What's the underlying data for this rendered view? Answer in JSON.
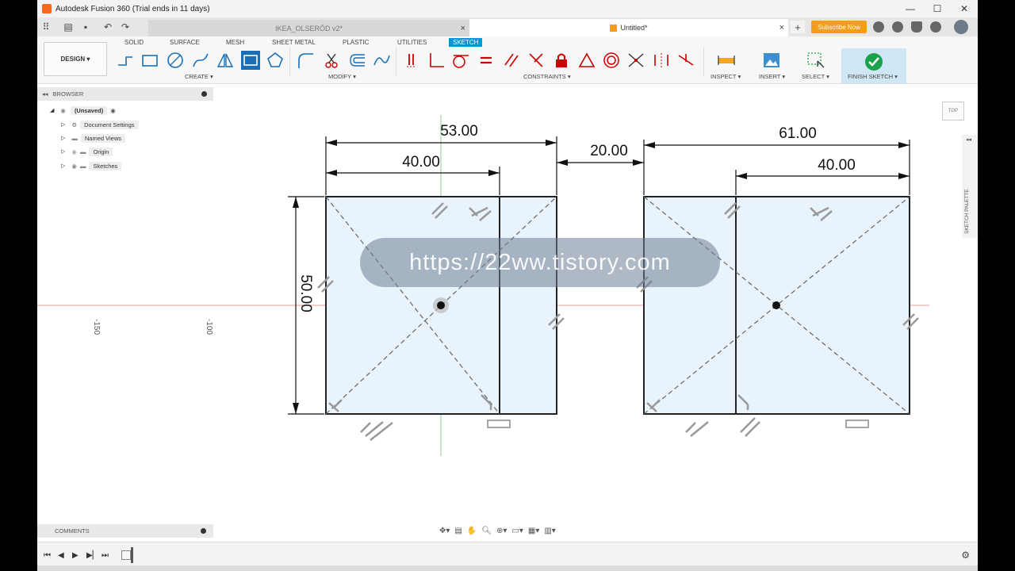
{
  "window": {
    "title": "Autodesk Fusion 360 (Trial ends in 11 days)"
  },
  "tabs": {
    "doc1": "IKEA_OLSERÖD v2*",
    "doc2": "Untitled*",
    "close": "×",
    "plus": "+"
  },
  "header": {
    "subscribe_label": "Subscribe Now"
  },
  "ribbon": {
    "tabs": [
      "SOLID",
      "SURFACE",
      "MESH",
      "SHEET METAL",
      "PLASTIC",
      "UTILITIES",
      "SKETCH"
    ],
    "workspace": "DESIGN ▾",
    "groups": {
      "create": "CREATE ▾",
      "modify": "MODIFY ▾",
      "constraints": "CONSTRAINTS ▾",
      "inspect": "INSPECT ▾",
      "insert": "INSERT ▾",
      "select": "SELECT ▾",
      "finish": "FINISH SKETCH ▾"
    }
  },
  "browser": {
    "title": "BROWSER",
    "root": "(Unsaved)",
    "items": [
      "Document Settings",
      "Named Views",
      "Origin",
      "Sketches"
    ]
  },
  "comments": {
    "title": "COMMENTS"
  },
  "canvas": {
    "axis_ticks": [
      "-150",
      "-100"
    ],
    "dimensions": {
      "left_total": "53.00",
      "left_inner": "40.00",
      "gap": "20.00",
      "right_total": "61.00",
      "right_inner": "40.00",
      "height": "50.00"
    },
    "viewcube_label": "TOP",
    "palette_label": "SKETCH PALETTE",
    "watermark": "https://22ww.tistory.com"
  },
  "colors": {
    "accent": "#0696d7",
    "sketch_fill": "#e8f3fb",
    "axis_red": "#e89a9a",
    "axis_green": "#8fd08f",
    "subscribe": "#f59c1a"
  }
}
